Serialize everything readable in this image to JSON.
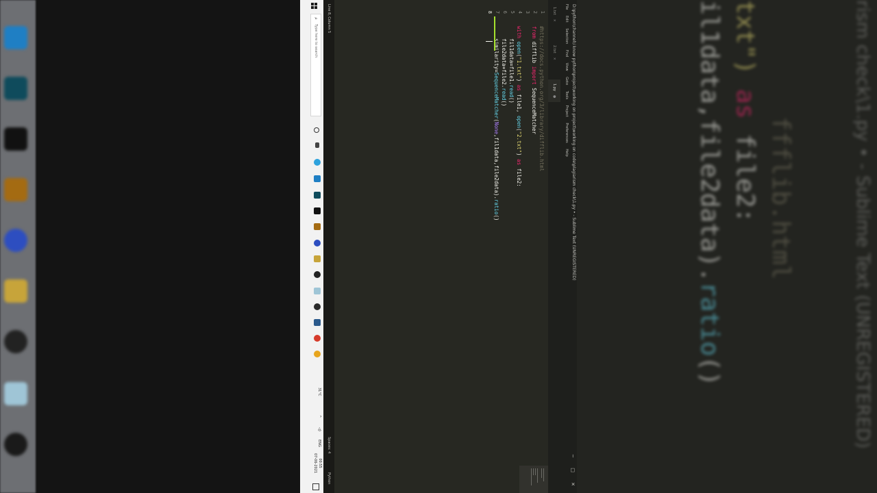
{
  "window": {
    "title": "D:\\python\\channel\\i know python\\project\\working on project\\working on code\\plagiarism check\\1.py • - Sublime Text (UNREGISTERED)",
    "menu": [
      "File",
      "Edit",
      "Selection",
      "Find",
      "View",
      "Goto",
      "Tools",
      "Project",
      "Preferences",
      "Help"
    ],
    "controls": [
      "−",
      "□",
      "✕"
    ]
  },
  "tabs": [
    {
      "label": "1.txt",
      "close": "×",
      "active": false
    },
    {
      "label": "2.txt",
      "close": "×",
      "active": false
    },
    {
      "label": "1.py",
      "close": "●",
      "active": true
    }
  ],
  "editor": {
    "line_numbers": [
      "1",
      "2",
      "3",
      "4",
      "5",
      "6",
      "7",
      "8"
    ],
    "current_line": "8",
    "lines": [
      [
        {
          "t": "#https://docs.python.org/3/library/difflib.html",
          "c": "comment"
        }
      ],
      [
        {
          "t": "from",
          "c": "kw"
        },
        {
          "t": " difflib ",
          "c": "def"
        },
        {
          "t": "import",
          "c": "kw"
        },
        {
          "t": " SequenceMatcher",
          "c": "def"
        }
      ],
      [],
      [
        {
          "t": "with",
          "c": "kw"
        },
        {
          "t": " ",
          "c": "def"
        },
        {
          "t": "open",
          "c": "fn"
        },
        {
          "t": "(",
          "c": "def"
        },
        {
          "t": "\"1.txt\"",
          "c": "str"
        },
        {
          "t": ") ",
          "c": "def"
        },
        {
          "t": "as",
          "c": "kw"
        },
        {
          "t": " file1, ",
          "c": "def"
        },
        {
          "t": "open",
          "c": "fn"
        },
        {
          "t": "(",
          "c": "def"
        },
        {
          "t": "\"2.txt\"",
          "c": "str"
        },
        {
          "t": ") ",
          "c": "def"
        },
        {
          "t": "as",
          "c": "kw"
        },
        {
          "t": " file2:",
          "c": "def"
        }
      ],
      [
        {
          "t": "    fil1data=file1.",
          "c": "def"
        },
        {
          "t": "read",
          "c": "fn"
        },
        {
          "t": "()",
          "c": "def"
        }
      ],
      [
        {
          "t": "    file2data=file2.",
          "c": "def"
        },
        {
          "t": "read",
          "c": "fn"
        },
        {
          "t": "()",
          "c": "def"
        }
      ],
      [
        {
          "t": "    similarity=",
          "c": "def"
        },
        {
          "t": "SequenceMatcher",
          "c": "fn"
        },
        {
          "t": "(",
          "c": "def"
        },
        {
          "t": "None",
          "c": "const"
        },
        {
          "t": ",fil1data,file2data).",
          "c": "def"
        },
        {
          "t": "ratio",
          "c": "fn"
        },
        {
          "t": "()",
          "c": "def"
        }
      ],
      []
    ]
  },
  "statusbar": {
    "position": "Line 8, Column 5",
    "indent": "Spaces: 4",
    "syntax": "Python"
  },
  "taskbar": {
    "search_placeholder": "Type here to search",
    "tray_temp": "31°C",
    "tray_lang": "ENG",
    "time": "00:55",
    "date": "07-06-2021"
  },
  "background": {
    "title": "rism check\\1.py • - Sublime Text (UNREGISTERED)",
    "lines": [
      [
        {
          "t": "ffflib.html",
          "c": "comment"
        }
      ],
      [
        {
          "t": "txt\") ",
          "c": "str"
        },
        {
          "t": "as",
          "c": "kw"
        },
        {
          "t": " file2:",
          "c": "def"
        }
      ],
      [
        {
          "t": "il1data,file2data).",
          "c": "def"
        },
        {
          "t": "ratio",
          "c": "fn"
        },
        {
          "t": "()",
          "c": "def"
        }
      ]
    ]
  },
  "colors": {
    "editor_bg": "#272822",
    "comment": "#75715e",
    "keyword": "#f92672",
    "function": "#66d9ef",
    "string": "#e6db74",
    "default": "#f8f8f2",
    "constant": "#ae81ff",
    "modified_marker": "#a6e22e"
  }
}
